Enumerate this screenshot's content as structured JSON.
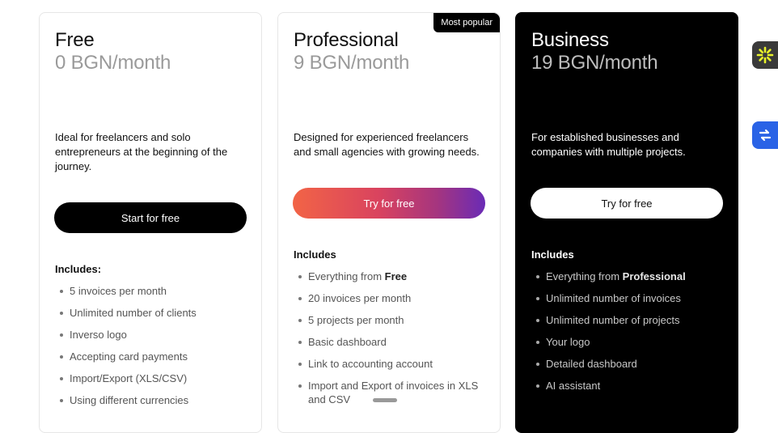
{
  "plans": [
    {
      "name": "Free",
      "price": "0 BGN/month",
      "description": "Ideal for freelancers and solo entrepreneurs at the beginning of the journey.",
      "cta": "Start for free",
      "includes_heading": "Includes:",
      "features": [
        {
          "text": "5 invoices per month"
        },
        {
          "text": "Unlimited number of clients"
        },
        {
          "text": "Inverso logo"
        },
        {
          "text": "Accepting card payments"
        },
        {
          "text": "Import/Export (XLS/CSV)"
        },
        {
          "text": "Using different currencies"
        }
      ]
    },
    {
      "name": "Professional",
      "price": "9 BGN/month",
      "badge": "Most popular",
      "description": "Designed for experienced freelancers and small agencies with growing needs.",
      "cta": "Try for free",
      "includes_heading": "Includes",
      "features": [
        {
          "prefix": "Everything from ",
          "strong": "Free"
        },
        {
          "text": "20 invoices per month"
        },
        {
          "text": "5 projects per month"
        },
        {
          "text": "Basic dashboard"
        },
        {
          "text": "Link to accounting account"
        },
        {
          "text": "Import and Export of invoices in XLS and CSV"
        }
      ]
    },
    {
      "name": "Business",
      "price": "19 BGN/month",
      "description": "For established businesses and companies with multiple projects.",
      "cta": "Try for free",
      "includes_heading": "Includes",
      "features": [
        {
          "prefix": "Everything from ",
          "strong": "Professional"
        },
        {
          "text": "Unlimited number of invoices"
        },
        {
          "text": "Unlimited number of projects"
        },
        {
          "text": "Your logo"
        },
        {
          "text": "Detailed dashboard"
        },
        {
          "text": "AI assistant"
        }
      ]
    }
  ],
  "side_widgets": [
    {
      "icon": "asterisk-sparkle-icon",
      "bg": "#3a3a3a",
      "fg": "#e8f22a"
    },
    {
      "icon": "translate-icon",
      "bg": "#2a63e6",
      "fg": "#ffffff"
    }
  ],
  "colors": {
    "accent_gradient_start": "#f26446",
    "accent_gradient_end": "#6a2bb6",
    "dark_card": "#000000"
  }
}
